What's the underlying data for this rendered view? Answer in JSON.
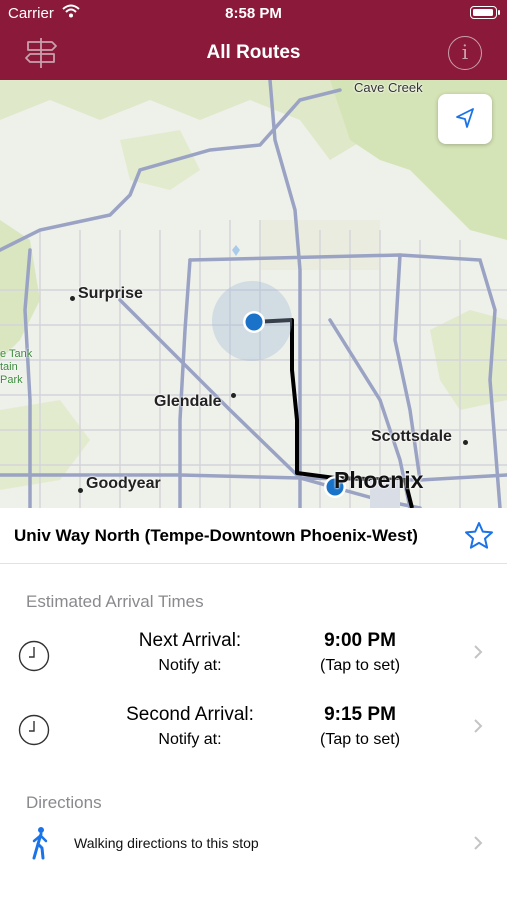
{
  "status_bar": {
    "carrier": "Carrier",
    "time": "8:58 PM",
    "battery_level": 0.9
  },
  "nav": {
    "title": "All Routes",
    "routes_icon": "signpost-icon",
    "info_icon": "info-icon",
    "info_glyph": "i"
  },
  "map": {
    "locate_icon": "location-arrow-icon",
    "places": {
      "cave_creek": "Cave Creek",
      "surprise": "Surprise",
      "tank": "e Tank",
      "tain": "tain",
      "park": "Park",
      "glendale": "Glendale",
      "scottsdale": "Scottsdale",
      "goodyear": "Goodyear",
      "phoenix": "Phoenix"
    }
  },
  "route": {
    "name": "Univ Way North (Tempe-Downtown Phoenix-West)",
    "favorite_icon": "star-outline-icon"
  },
  "arrivals_section": {
    "title": "Estimated Arrival Times",
    "rows": [
      {
        "label": "Next Arrival:",
        "notify_label": "Notify at:",
        "time": "9:00 PM",
        "notify_value": "(Tap to set)"
      },
      {
        "label": "Second Arrival:",
        "notify_label": "Notify at:",
        "time": "9:15 PM",
        "notify_value": "(Tap to set)"
      }
    ]
  },
  "directions_section": {
    "title": "Directions",
    "walking_label": "Walking directions to this stop",
    "walking_icon": "walking-person-icon"
  },
  "colors": {
    "brand": "#8b1a3a",
    "accent": "#1a73e8",
    "route_line": "#000000",
    "section_gray": "#8a8a8e"
  }
}
